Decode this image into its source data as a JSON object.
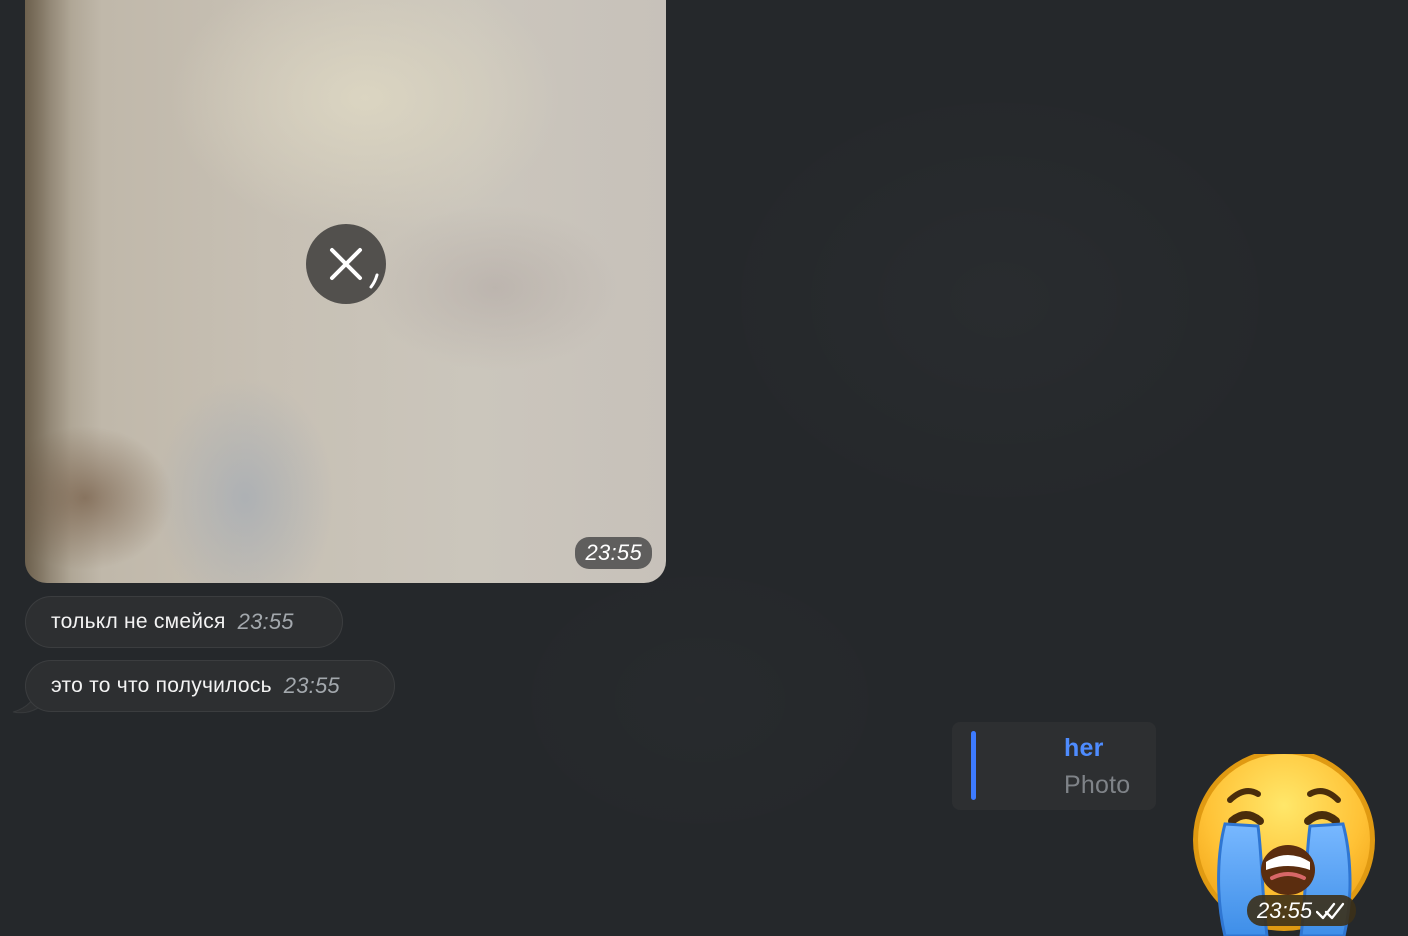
{
  "conversation": {
    "incoming_photo": {
      "close_icon": "close-icon",
      "time": "23:55"
    },
    "incoming_messages": [
      {
        "text": "толькл не смейся",
        "time": "23:55"
      },
      {
        "text": "это то что получилось",
        "time": "23:55"
      }
    ],
    "outgoing_reply": {
      "author": "her",
      "label": "Photo"
    },
    "outgoing_sticker": {
      "icon": "crying-face-sticker",
      "time": "23:55",
      "status_icon": "double-check-icon"
    }
  },
  "colors": {
    "background": "#25282b",
    "bubble": "#2d2f31",
    "accent": "#4e8cff",
    "time": "#a3a8ad"
  }
}
